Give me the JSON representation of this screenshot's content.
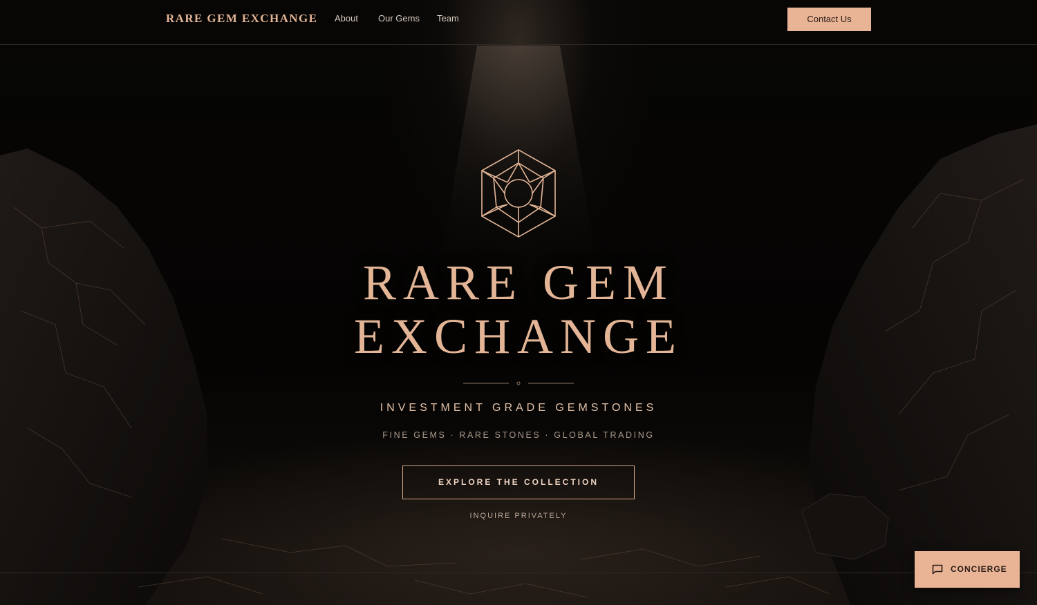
{
  "nav": {
    "brand": "RARE GEM EXCHANGE",
    "links": [
      "About",
      "Our Gems",
      "Team"
    ],
    "contact_label": "Contact Us"
  },
  "hero": {
    "title_line1": "RARE GEM",
    "title_line2": "EXCHANGE",
    "tagline": "INVESTMENT GRADE GEMSTONES",
    "subline": "FINE GEMS · RARE STONES · GLOBAL TRADING",
    "explore_label": "EXPLORE THE COLLECTION",
    "inquire_label": "INQUIRE PRIVATELY",
    "emblem_icon": "gem-hexagon-icon"
  },
  "concierge": {
    "label": "CONCIERGE",
    "icon": "chat-bubble-icon"
  },
  "colors": {
    "accent": "#e9b496",
    "title": "#e3b596",
    "background": "#050403",
    "button_text": "#2a1c15"
  }
}
